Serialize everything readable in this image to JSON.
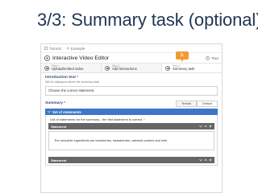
{
  "slide": {
    "title": "3/3: Summary task (optional)"
  },
  "breadcrumb": {
    "items": [
      "Tutorial",
      "Example"
    ]
  },
  "editor": {
    "title": "Interactive Video Editor",
    "tour_label": "Tour",
    "steps": [
      {
        "number": "Step 1",
        "label": "Upload/embed video"
      },
      {
        "number": "Step 2",
        "label": "Add interactions"
      },
      {
        "number": "Step 3",
        "label": "Summary task"
      }
    ],
    "callout": "3.",
    "intro": {
      "label": "Introduction text",
      "required": "*",
      "description": "Will be displayed above the summary task",
      "value": "Choose the correct statement."
    },
    "summary": {
      "label": "Summary",
      "required": "*",
      "textual_button": "Textual",
      "default_button": "Default",
      "set_label": "Set of statements",
      "list_label": "List of statements for the summary - the first statement is correct.",
      "statements": [
        {
          "label": "Statement",
          "value": "The smoothie ingredients are blueberries, strawberries, oatmeal cookies and milk."
        },
        {
          "label": "Statement",
          "value": ""
        }
      ]
    }
  },
  "colors": {
    "accent": "#3d77c7",
    "callout": "#f29b2f",
    "slide_title": "#1f3554"
  }
}
